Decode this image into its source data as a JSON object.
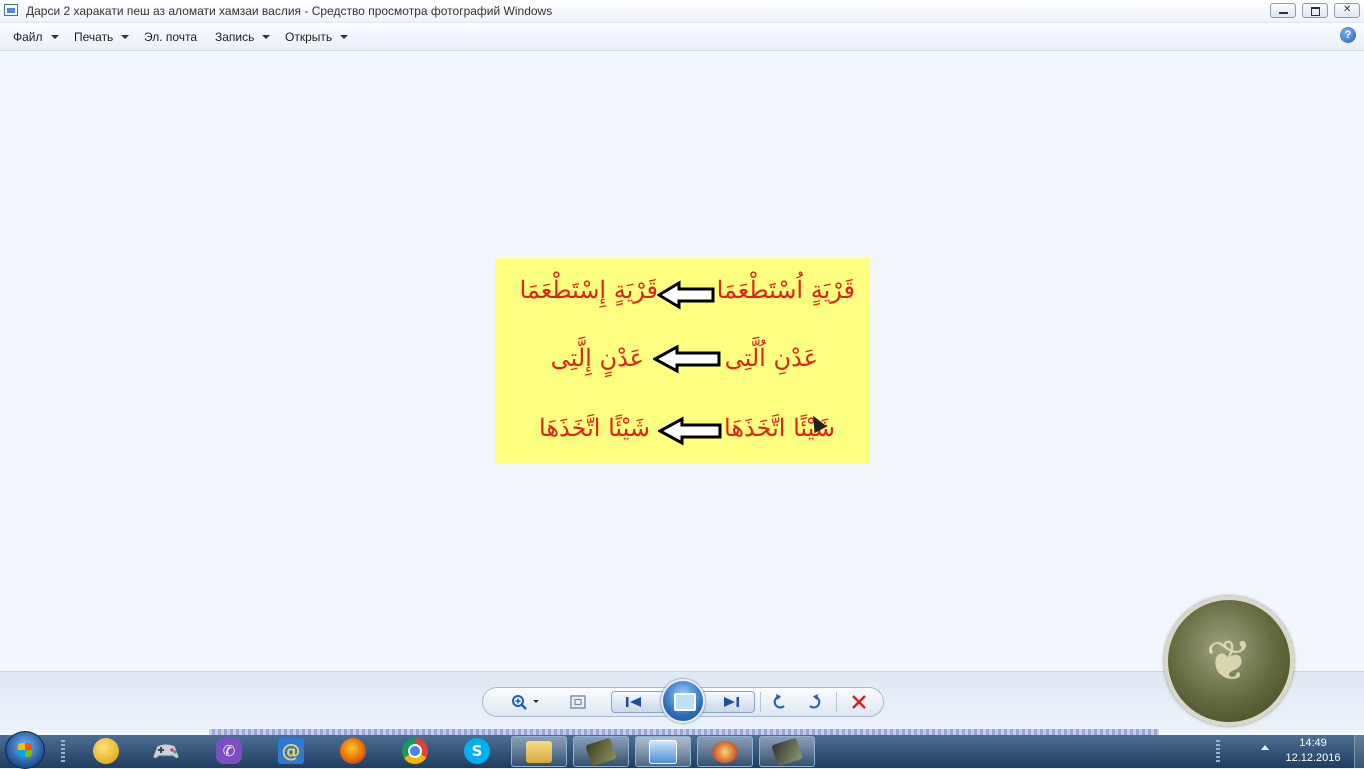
{
  "window": {
    "title": "Дарси 2 харакати пеш аз аломати хамзаи васлия - Средство просмотра фотографий Windows",
    "minimize_icon": "minimize-icon",
    "maximize_icon": "restore-icon",
    "close_icon": "close-icon"
  },
  "menubar": {
    "items": [
      {
        "label": "Файл",
        "has_dropdown": true
      },
      {
        "label": "Печать",
        "has_dropdown": true
      },
      {
        "label": "Эл. почта",
        "has_dropdown": false
      },
      {
        "label": "Запись",
        "has_dropdown": true
      },
      {
        "label": "Открыть",
        "has_dropdown": true
      }
    ],
    "help_label": "?"
  },
  "photo": {
    "background": "#ffff80",
    "text_color": "#e0221c",
    "rows": [
      {
        "left": "قَرْيَةٍ إِسْتَطْعَمَا",
        "right": "قَرْيَةٍ اُسْتَطْعَمَا"
      },
      {
        "left": "عَدْنٍ إِلَّتِى",
        "right": "عَدْنِ اُلَّتِى"
      },
      {
        "left": "شَيْئًا اتَّخَذَهَا",
        "right": "شَيْئًا اتَّخَذَهَا"
      }
    ],
    "arrow_icon": "left-arrow-icon"
  },
  "toolbar": {
    "zoom_icon": "zoom-icon",
    "fit_icon": "actual-size-icon",
    "prev_icon": "previous-icon",
    "slideshow_icon": "slideshow-icon",
    "next_icon": "next-icon",
    "rotate_left_icon": "rotate-counterclockwise-icon",
    "rotate_right_icon": "rotate-clockwise-icon",
    "delete_icon": "delete-icon",
    "accent": "#1f5fb8",
    "delete_color": "#d42020"
  },
  "taskbar": {
    "pinned": [
      {
        "name": "windows-media-center",
        "icon": "media-center-icon",
        "color": "#2a6bd1"
      },
      {
        "name": "games",
        "icon": "gamepad-icon",
        "color": "#7a8ea6"
      },
      {
        "name": "viber",
        "icon": "viber-icon",
        "color": "#7b4fbf"
      },
      {
        "name": "mail-agent",
        "icon": "at-sign-icon",
        "color": "#2c7ad6"
      },
      {
        "name": "firefox",
        "icon": "firefox-icon",
        "color": "#e66000"
      },
      {
        "name": "chrome",
        "icon": "chrome-icon",
        "color": "#db4437"
      },
      {
        "name": "skype",
        "icon": "skype-icon",
        "color": "#00aff0"
      }
    ],
    "running": [
      {
        "name": "explorer",
        "icon": "folder-icon",
        "color": "#e9c45c"
      },
      {
        "name": "app-book",
        "icon": "book-icon",
        "color": "#7c8450"
      },
      {
        "name": "photo-viewer",
        "icon": "photo-viewer-icon",
        "color": "#6ba3dd"
      },
      {
        "name": "presentation",
        "icon": "presentation-icon",
        "color": "#c9572a"
      },
      {
        "name": "recorder",
        "icon": "recorder-icon",
        "color": "#6c7b5a"
      }
    ],
    "clock": {
      "time": "14:49",
      "date": "12.12.2016"
    }
  }
}
